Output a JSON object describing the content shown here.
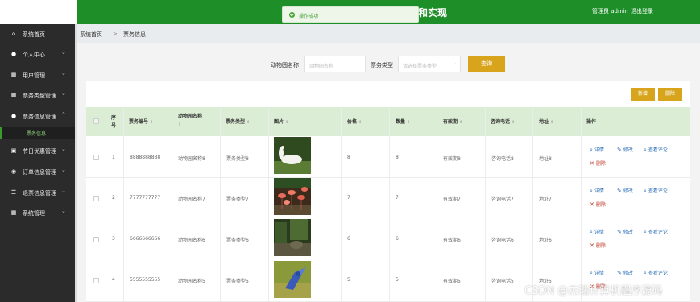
{
  "header": {
    "title": "和实现",
    "admin_label": "管理员 admin",
    "logout_label": "退出登录"
  },
  "toast": {
    "message": "操作成功"
  },
  "sidebar": {
    "items": [
      {
        "label": "系统首页",
        "icon": "home-icon"
      },
      {
        "label": "个人中心",
        "icon": "user-icon"
      },
      {
        "label": "用户管理",
        "icon": "grid-icon"
      },
      {
        "label": "票务类型管理",
        "icon": "grid-icon"
      },
      {
        "label": "票务信息管理",
        "icon": "user-icon"
      },
      {
        "label": "节日优惠管理",
        "icon": "gift-icon"
      },
      {
        "label": "订单信息管理",
        "icon": "pin-icon"
      },
      {
        "label": "退票信息管理",
        "icon": "sliders-icon"
      },
      {
        "label": "系统管理",
        "icon": "grid-icon"
      }
    ],
    "active_sub": "票务信息"
  },
  "breadcrumb": {
    "home": "系统首页",
    "separator": ">",
    "current": "票务信息"
  },
  "search": {
    "name_label": "动物园名称",
    "name_placeholder": "动物园名称",
    "type_label": "票务类型",
    "type_placeholder": "请选择票务类型",
    "query_button": "查询"
  },
  "toolbar": {
    "add_label": "新增",
    "delete_label": "删除"
  },
  "table": {
    "columns": {
      "seq": "序号",
      "ticket_no": "票务编号",
      "zoo_name": "动物园名称",
      "ticket_type": "票务类型",
      "image": "图片",
      "price": "价格",
      "quantity": "数量",
      "validity": "有效期",
      "phone": "咨询电话",
      "address": "地址",
      "actions": "操作"
    },
    "actions": {
      "detail": "详情",
      "edit": "修改",
      "review": "查看评论",
      "remove": "删除"
    },
    "rows": [
      {
        "seq": "1",
        "ticket_no": "8888888888",
        "zoo_name": "动物园名称8",
        "ticket_type": "票务类型8",
        "price": "8",
        "quantity": "8",
        "validity": "有效期8",
        "phone": "咨询电话8",
        "address": "地址8",
        "photo": "swan"
      },
      {
        "seq": "2",
        "ticket_no": "7777777777",
        "zoo_name": "动物园名称7",
        "ticket_type": "票务类型7",
        "price": "7",
        "quantity": "7",
        "validity": "有效期7",
        "phone": "咨询电话7",
        "address": "地址7",
        "photo": "flamingo"
      },
      {
        "seq": "3",
        "ticket_no": "6666666666",
        "zoo_name": "动物园名称6",
        "ticket_type": "票务类型6",
        "price": "6",
        "quantity": "6",
        "validity": "有效期6",
        "phone": "咨询电话6",
        "address": "地址6",
        "photo": "forest"
      },
      {
        "seq": "4",
        "ticket_no": "5555555555",
        "zoo_name": "动物园名称5",
        "ticket_type": "票务类型5",
        "price": "5",
        "quantity": "5",
        "validity": "有效期5",
        "phone": "咨询电话5",
        "address": "地址5",
        "photo": "parrot"
      }
    ]
  },
  "watermark": "CSDN @杰瑞计算机程序源码",
  "colors": {
    "header_green": "#1e8e28",
    "accent_gold": "#d8a41b",
    "table_head": "#dcedd5",
    "sidebar_bg": "#2b2b2b"
  }
}
